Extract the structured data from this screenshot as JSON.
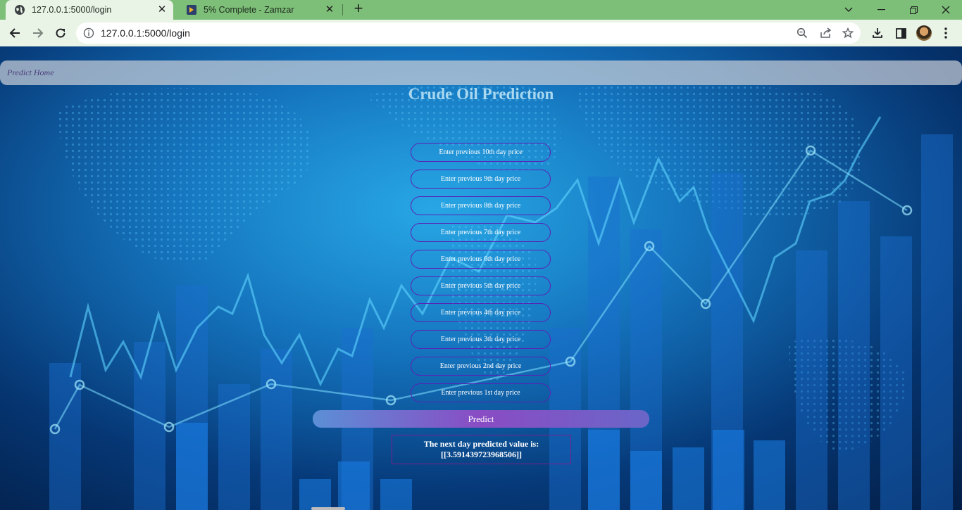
{
  "browser": {
    "tabs": [
      {
        "title": "127.0.0.1:5000/login",
        "active": true,
        "icon": "globe-icon"
      },
      {
        "title": "5% Complete - Zamzar",
        "active": false,
        "icon": "zamzar-icon"
      }
    ],
    "address": "127.0.0.1:5000/login"
  },
  "nav": {
    "link": "Predict Home"
  },
  "page": {
    "heading": "Crude Oil Prediction",
    "fields": [
      {
        "placeholder": "Enter previous 10th day price"
      },
      {
        "placeholder": "Enter previous 9th day price"
      },
      {
        "placeholder": "Enter previous 8th day price"
      },
      {
        "placeholder": "Enter previous 7th day price"
      },
      {
        "placeholder": "Enter previous 6th day price"
      },
      {
        "placeholder": "Enter previous 5th day price"
      },
      {
        "placeholder": "Enter previous 4th day price"
      },
      {
        "placeholder": "Enter previous 3th day price"
      },
      {
        "placeholder": "Enter previous 2nd day price"
      },
      {
        "placeholder": "Enter previous 1st day price"
      }
    ],
    "predict_label": "Predict",
    "result_label": "The next day predicted value is:",
    "result_value": "[[3.591439723968506]]"
  },
  "colors": {
    "accent": "#5b21b6",
    "tabstrip": "#7dbf78",
    "heading": "#a9d8f0"
  }
}
